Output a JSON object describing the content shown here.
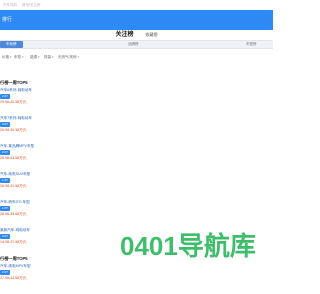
{
  "topnote": {
    "left": "汽车导航",
    "right": "首页/关注榜"
  },
  "header": {
    "title": "排行"
  },
  "rank_tabs": [
    {
      "label": "关注榜",
      "active": true
    },
    {
      "label": "收藏榜",
      "active": false
    }
  ],
  "categories": [
    {
      "label": "车系榜",
      "active": true
    },
    {
      "label": "品牌榜",
      "active": false
    },
    {
      "label": "车型榜",
      "active": false
    }
  ],
  "filters": [
    {
      "label": "价格",
      "has_caret": true
    },
    {
      "label": "车型",
      "has_caret": true
    },
    {
      "label": "能源",
      "has_caret": true
    },
    {
      "label": "排量",
      "has_caret": true
    },
    {
      "label": "天然气/其他",
      "has_caret": true
    }
  ],
  "groups": [
    {
      "title": "行榜一周TOP5",
      "items": [
        {
          "name": "汽车6系列-纯电动车",
          "badge1": "2.0T",
          "badge2": "",
          "price": "29.98-42.38万元"
        },
        {
          "name": "汽车7系列-纯电动车",
          "badge1": "2.0T",
          "badge2": "",
          "price": "26.98-30.38万元"
        },
        {
          "name": "汽车-某品牌MPV车型",
          "badge1": "2.0T",
          "badge2": "",
          "price": "26.98-43.58万元"
        },
        {
          "name": "汽车-纯电SUV车型",
          "badge1": "1.5T",
          "badge2": "",
          "price": "26.98-41.58万元"
        },
        {
          "name": "汽车-轿车GTL车型",
          "badge1": "1.5T",
          "badge2": "",
          "price": "28.98-35.58万元"
        },
        {
          "name": "某款汽车-纯电动车",
          "badge1": "2.0T",
          "badge2": "",
          "price": "16.98-27.98万元"
        }
      ]
    },
    {
      "title": "行榜一周TOP5",
      "items": [
        {
          "name": "汽车-纯电MPV车型",
          "badge1": "2.0T",
          "badge2": "",
          "price": "27.98-42.58万元"
        }
      ]
    }
  ],
  "watermark": {
    "text": "0401导航库",
    "color": "#3ebd6a"
  },
  "colors": {
    "header": "#2f89f4",
    "price": "#e24a1e",
    "link": "#1f5fbf"
  }
}
